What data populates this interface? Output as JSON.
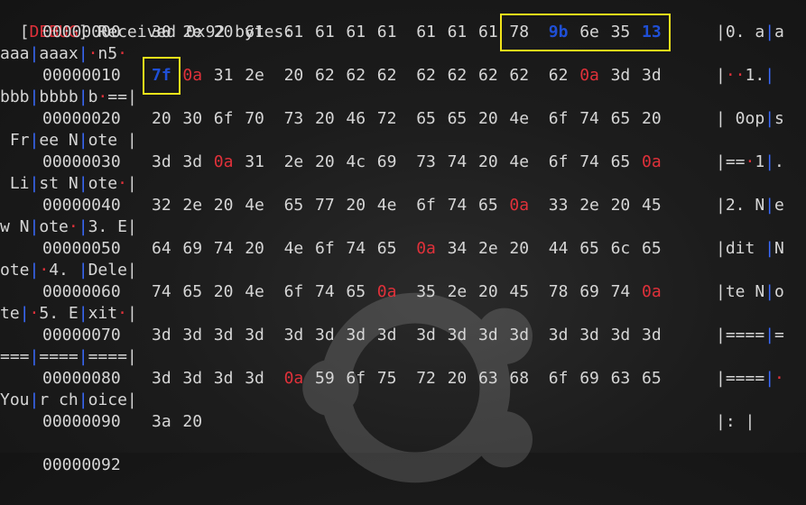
{
  "header": {
    "tag": "DEBUG",
    "text": "Received 0x92 bytes:"
  },
  "rows": [
    {
      "offset": "00000000",
      "bytes": [
        [
          "30",
          ""
        ],
        [
          "2e",
          ""
        ],
        [
          "20",
          ""
        ],
        [
          "61",
          ""
        ],
        [
          "61",
          ""
        ],
        [
          "61",
          ""
        ],
        [
          "61",
          ""
        ],
        [
          "61",
          ""
        ],
        [
          "61",
          ""
        ],
        [
          "61",
          ""
        ],
        [
          "61",
          ""
        ],
        [
          "78",
          ""
        ],
        [
          "9b",
          "blue"
        ],
        [
          "6e",
          ""
        ],
        [
          "35",
          ""
        ],
        [
          "13",
          "blue"
        ]
      ],
      "ascii": [
        [
          "|",
          ""
        ],
        [
          "0. a",
          ""
        ],
        [
          "|",
          "bar"
        ],
        [
          "a",
          ""
        ]
      ],
      "cont": [
        [
          "aaa",
          ""
        ],
        [
          "|",
          "bar"
        ],
        [
          "aaax",
          ""
        ],
        [
          "|",
          "bar"
        ],
        [
          "·",
          "dot"
        ],
        [
          "n5",
          ""
        ],
        [
          "·",
          "dot"
        ]
      ]
    },
    {
      "offset": "00000010",
      "bytes": [
        [
          "7f",
          "blue"
        ],
        [
          "0a",
          "red"
        ],
        [
          "31",
          ""
        ],
        [
          "2e",
          ""
        ],
        [
          "20",
          ""
        ],
        [
          "62",
          ""
        ],
        [
          "62",
          ""
        ],
        [
          "62",
          ""
        ],
        [
          "62",
          ""
        ],
        [
          "62",
          ""
        ],
        [
          "62",
          ""
        ],
        [
          "62",
          ""
        ],
        [
          "62",
          ""
        ],
        [
          "0a",
          "red"
        ],
        [
          "3d",
          ""
        ],
        [
          "3d",
          ""
        ]
      ],
      "ascii": [
        [
          "|",
          ""
        ],
        [
          "··",
          "dot"
        ],
        [
          "1.",
          ""
        ],
        [
          "|",
          "bar"
        ]
      ],
      "cont": [
        [
          "bbb",
          ""
        ],
        [
          "|",
          "bar"
        ],
        [
          "bbbb",
          ""
        ],
        [
          "|",
          "bar"
        ],
        [
          "b",
          ""
        ],
        [
          "·",
          "dot"
        ],
        [
          "==",
          ""
        ],
        [
          "|",
          ""
        ]
      ]
    },
    {
      "offset": "00000020",
      "bytes": [
        [
          "20",
          ""
        ],
        [
          "30",
          ""
        ],
        [
          "6f",
          ""
        ],
        [
          "70",
          ""
        ],
        [
          "73",
          ""
        ],
        [
          "20",
          ""
        ],
        [
          "46",
          ""
        ],
        [
          "72",
          ""
        ],
        [
          "65",
          ""
        ],
        [
          "65",
          ""
        ],
        [
          "20",
          ""
        ],
        [
          "4e",
          ""
        ],
        [
          "6f",
          ""
        ],
        [
          "74",
          ""
        ],
        [
          "65",
          ""
        ],
        [
          "20",
          ""
        ]
      ],
      "ascii": [
        [
          "| 0op",
          ""
        ],
        [
          "|",
          "bar"
        ],
        [
          "s",
          ""
        ]
      ],
      "cont": [
        [
          " Fr",
          ""
        ],
        [
          "|",
          "bar"
        ],
        [
          "ee N",
          ""
        ],
        [
          "|",
          "bar"
        ],
        [
          "ote |",
          ""
        ]
      ]
    },
    {
      "offset": "00000030",
      "bytes": [
        [
          "3d",
          ""
        ],
        [
          "3d",
          ""
        ],
        [
          "0a",
          "red"
        ],
        [
          "31",
          ""
        ],
        [
          "2e",
          ""
        ],
        [
          "20",
          ""
        ],
        [
          "4c",
          ""
        ],
        [
          "69",
          ""
        ],
        [
          "73",
          ""
        ],
        [
          "74",
          ""
        ],
        [
          "20",
          ""
        ],
        [
          "4e",
          ""
        ],
        [
          "6f",
          ""
        ],
        [
          "74",
          ""
        ],
        [
          "65",
          ""
        ],
        [
          "0a",
          "red"
        ]
      ],
      "ascii": [
        [
          "|==",
          ""
        ],
        [
          "·",
          "dot"
        ],
        [
          "1",
          ""
        ],
        [
          "|",
          "bar"
        ],
        [
          ".",
          ""
        ]
      ],
      "cont": [
        [
          " Li",
          ""
        ],
        [
          "|",
          "bar"
        ],
        [
          "st N",
          ""
        ],
        [
          "|",
          "bar"
        ],
        [
          "ote",
          ""
        ],
        [
          "·",
          "dot"
        ],
        [
          "|",
          ""
        ]
      ]
    },
    {
      "offset": "00000040",
      "bytes": [
        [
          "32",
          ""
        ],
        [
          "2e",
          ""
        ],
        [
          "20",
          ""
        ],
        [
          "4e",
          ""
        ],
        [
          "65",
          ""
        ],
        [
          "77",
          ""
        ],
        [
          "20",
          ""
        ],
        [
          "4e",
          ""
        ],
        [
          "6f",
          ""
        ],
        [
          "74",
          ""
        ],
        [
          "65",
          ""
        ],
        [
          "0a",
          "red"
        ],
        [
          "33",
          ""
        ],
        [
          "2e",
          ""
        ],
        [
          "20",
          ""
        ],
        [
          "45",
          ""
        ]
      ],
      "ascii": [
        [
          "|2. N",
          ""
        ],
        [
          "|",
          "bar"
        ],
        [
          "e",
          ""
        ]
      ],
      "cont": [
        [
          "w N",
          ""
        ],
        [
          "|",
          "bar"
        ],
        [
          "ote",
          ""
        ],
        [
          "·",
          "dot"
        ],
        [
          "|",
          "bar"
        ],
        [
          "3. E",
          ""
        ],
        [
          "|",
          ""
        ]
      ]
    },
    {
      "offset": "00000050",
      "bytes": [
        [
          "64",
          ""
        ],
        [
          "69",
          ""
        ],
        [
          "74",
          ""
        ],
        [
          "20",
          ""
        ],
        [
          "4e",
          ""
        ],
        [
          "6f",
          ""
        ],
        [
          "74",
          ""
        ],
        [
          "65",
          ""
        ],
        [
          "0a",
          "red"
        ],
        [
          "34",
          ""
        ],
        [
          "2e",
          ""
        ],
        [
          "20",
          ""
        ],
        [
          "44",
          ""
        ],
        [
          "65",
          ""
        ],
        [
          "6c",
          ""
        ],
        [
          "65",
          ""
        ]
      ],
      "ascii": [
        [
          "|dit ",
          ""
        ],
        [
          "|",
          "bar"
        ],
        [
          "N",
          ""
        ]
      ],
      "cont": [
        [
          "ote",
          ""
        ],
        [
          "|",
          "bar"
        ],
        [
          "·",
          "dot"
        ],
        [
          "4. ",
          ""
        ],
        [
          "|",
          "bar"
        ],
        [
          "Dele",
          ""
        ],
        [
          "|",
          ""
        ]
      ]
    },
    {
      "offset": "00000060",
      "bytes": [
        [
          "74",
          ""
        ],
        [
          "65",
          ""
        ],
        [
          "20",
          ""
        ],
        [
          "4e",
          ""
        ],
        [
          "6f",
          ""
        ],
        [
          "74",
          ""
        ],
        [
          "65",
          ""
        ],
        [
          "0a",
          "red"
        ],
        [
          "35",
          ""
        ],
        [
          "2e",
          ""
        ],
        [
          "20",
          ""
        ],
        [
          "45",
          ""
        ],
        [
          "78",
          ""
        ],
        [
          "69",
          ""
        ],
        [
          "74",
          ""
        ],
        [
          "0a",
          "red"
        ]
      ],
      "ascii": [
        [
          "|te N",
          ""
        ],
        [
          "|",
          "bar"
        ],
        [
          "o",
          ""
        ]
      ],
      "cont": [
        [
          "te",
          ""
        ],
        [
          "|",
          "bar"
        ],
        [
          "·",
          "dot"
        ],
        [
          "5. E",
          ""
        ],
        [
          "|",
          "bar"
        ],
        [
          "xit",
          ""
        ],
        [
          "·",
          "dot"
        ],
        [
          "|",
          ""
        ]
      ]
    },
    {
      "offset": "00000070",
      "bytes": [
        [
          "3d",
          ""
        ],
        [
          "3d",
          ""
        ],
        [
          "3d",
          ""
        ],
        [
          "3d",
          ""
        ],
        [
          "3d",
          ""
        ],
        [
          "3d",
          ""
        ],
        [
          "3d",
          ""
        ],
        [
          "3d",
          ""
        ],
        [
          "3d",
          ""
        ],
        [
          "3d",
          ""
        ],
        [
          "3d",
          ""
        ],
        [
          "3d",
          ""
        ],
        [
          "3d",
          ""
        ],
        [
          "3d",
          ""
        ],
        [
          "3d",
          ""
        ],
        [
          "3d",
          ""
        ]
      ],
      "ascii": [
        [
          "|====",
          ""
        ],
        [
          "|",
          "bar"
        ],
        [
          "=",
          ""
        ]
      ],
      "cont": [
        [
          "===",
          ""
        ],
        [
          "|",
          "bar"
        ],
        [
          "====",
          ""
        ],
        [
          "|",
          "bar"
        ],
        [
          "====",
          ""
        ],
        [
          "|",
          ""
        ]
      ]
    },
    {
      "offset": "00000080",
      "bytes": [
        [
          "3d",
          ""
        ],
        [
          "3d",
          ""
        ],
        [
          "3d",
          ""
        ],
        [
          "3d",
          ""
        ],
        [
          "0a",
          "red"
        ],
        [
          "59",
          ""
        ],
        [
          "6f",
          ""
        ],
        [
          "75",
          ""
        ],
        [
          "72",
          ""
        ],
        [
          "20",
          ""
        ],
        [
          "63",
          ""
        ],
        [
          "68",
          ""
        ],
        [
          "6f",
          ""
        ],
        [
          "69",
          ""
        ],
        [
          "63",
          ""
        ],
        [
          "65",
          ""
        ]
      ],
      "ascii": [
        [
          "|====",
          ""
        ],
        [
          "|",
          "bar"
        ],
        [
          "·",
          "dot"
        ]
      ],
      "cont": [
        [
          "You",
          ""
        ],
        [
          "|",
          "bar"
        ],
        [
          "r ch",
          ""
        ],
        [
          "|",
          "bar"
        ],
        [
          "oice",
          ""
        ],
        [
          "|",
          ""
        ]
      ]
    },
    {
      "offset": "00000090",
      "bytes": [
        [
          "3a",
          ""
        ],
        [
          "20",
          ""
        ]
      ],
      "ascii": [
        [
          "|: |",
          ""
        ]
      ],
      "cont": []
    }
  ],
  "final_offset": "00000092",
  "highlights": [
    {
      "row": 0,
      "from": 11,
      "to": 15
    },
    {
      "row": 1,
      "from": 0,
      "to": 0
    }
  ]
}
